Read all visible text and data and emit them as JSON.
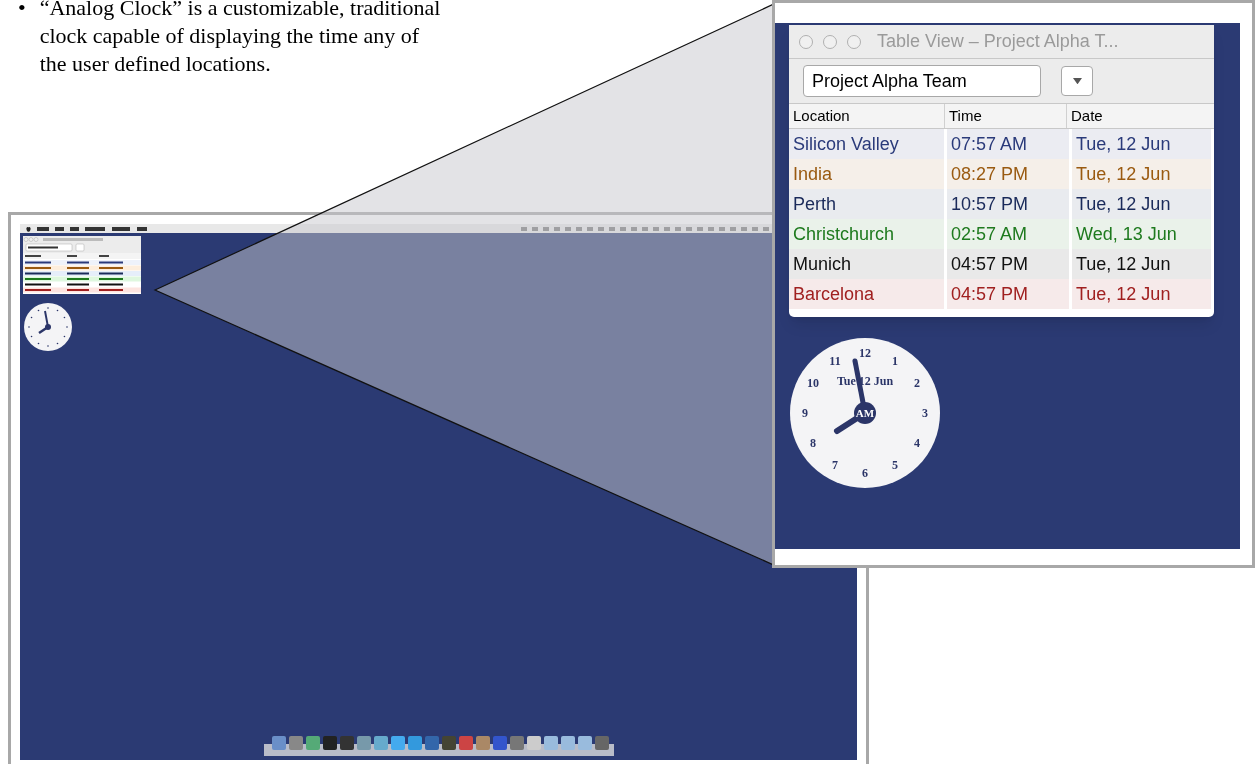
{
  "bullet": {
    "marker": "•",
    "text": "“Analog Clock” is a customizable, traditional clock capable of displaying the time any of the user defined locations."
  },
  "zoom_view": {
    "window": {
      "title": "Table View – Project Alpha T...",
      "popup": "Project Alpha Team",
      "columns": [
        "Location",
        "Time",
        "Date"
      ],
      "rows": [
        {
          "cells": [
            "Silicon Valley",
            "07:57 AM",
            "Tue, 12 Jun"
          ],
          "color": "#2a3a7a"
        },
        {
          "cells": [
            "India",
            "08:27 PM",
            "Tue, 12 Jun"
          ],
          "color": "#9a5a10"
        },
        {
          "cells": [
            "Perth",
            "10:57 PM",
            "Tue, 12 Jun"
          ],
          "color": "#1a2a5a"
        },
        {
          "cells": [
            "Christchurch",
            "02:57 AM",
            "Wed, 13 Jun"
          ],
          "color": "#1e7a1e"
        },
        {
          "cells": [
            "Munich",
            "04:57 PM",
            "Tue, 12 Jun"
          ],
          "color": "#111111"
        },
        {
          "cells": [
            "Barcelona",
            "04:57 PM",
            "Tue, 12 Jun"
          ],
          "color": "#a02020"
        }
      ]
    },
    "clock": {
      "numerals": [
        "12",
        "1",
        "2",
        "3",
        "4",
        "5",
        "6",
        "7",
        "8",
        "9",
        "10",
        "11"
      ],
      "date": "Tue 12 Jun",
      "period": "AM"
    }
  }
}
